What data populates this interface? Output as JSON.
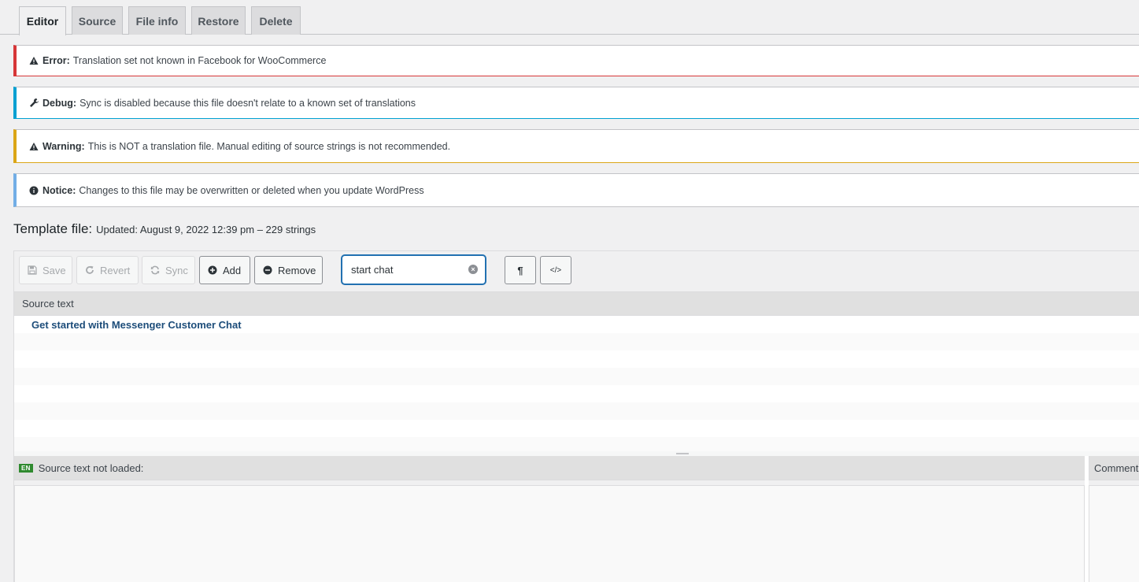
{
  "tabs": [
    {
      "label": "Editor",
      "active": true
    },
    {
      "label": "Source"
    },
    {
      "label": "File info"
    },
    {
      "label": "Restore"
    },
    {
      "label": "Delete"
    }
  ],
  "notices": {
    "error": {
      "label": "Error:",
      "text": "Translation set not known in Facebook for WooCommerce",
      "icon": "warning-icon",
      "color": "#d63638"
    },
    "debug": {
      "label": "Debug:",
      "text": "Sync is disabled because this file doesn't relate to a known set of translations",
      "icon": "wrench-icon",
      "color": "#00a0d2"
    },
    "warning": {
      "label": "Warning:",
      "text": "This is NOT a translation file. Manual editing of source strings is not recommended.",
      "icon": "warning-icon",
      "color": "#dba617"
    },
    "notice": {
      "label": "Notice:",
      "text": "Changes to this file may be overwritten or deleted when you update WordPress",
      "icon": "info-icon",
      "color": "#72aee6"
    }
  },
  "template": {
    "label": "Template file:",
    "meta": "Updated: August 9, 2022 12:39 pm – 229 strings"
  },
  "toolbar": {
    "save": "Save",
    "revert": "Revert",
    "sync": "Sync",
    "add": "Add",
    "remove": "Remove",
    "search_value": "start chat",
    "invisibles_icon": "¶",
    "code_icon": "</>"
  },
  "list": {
    "header": "Source text",
    "rows": [
      "Get started with Messenger Customer Chat"
    ]
  },
  "source_pane": {
    "lang_flag": "EN",
    "header": "Source text not loaded:"
  },
  "comments_pane": {
    "header": "Comments"
  }
}
